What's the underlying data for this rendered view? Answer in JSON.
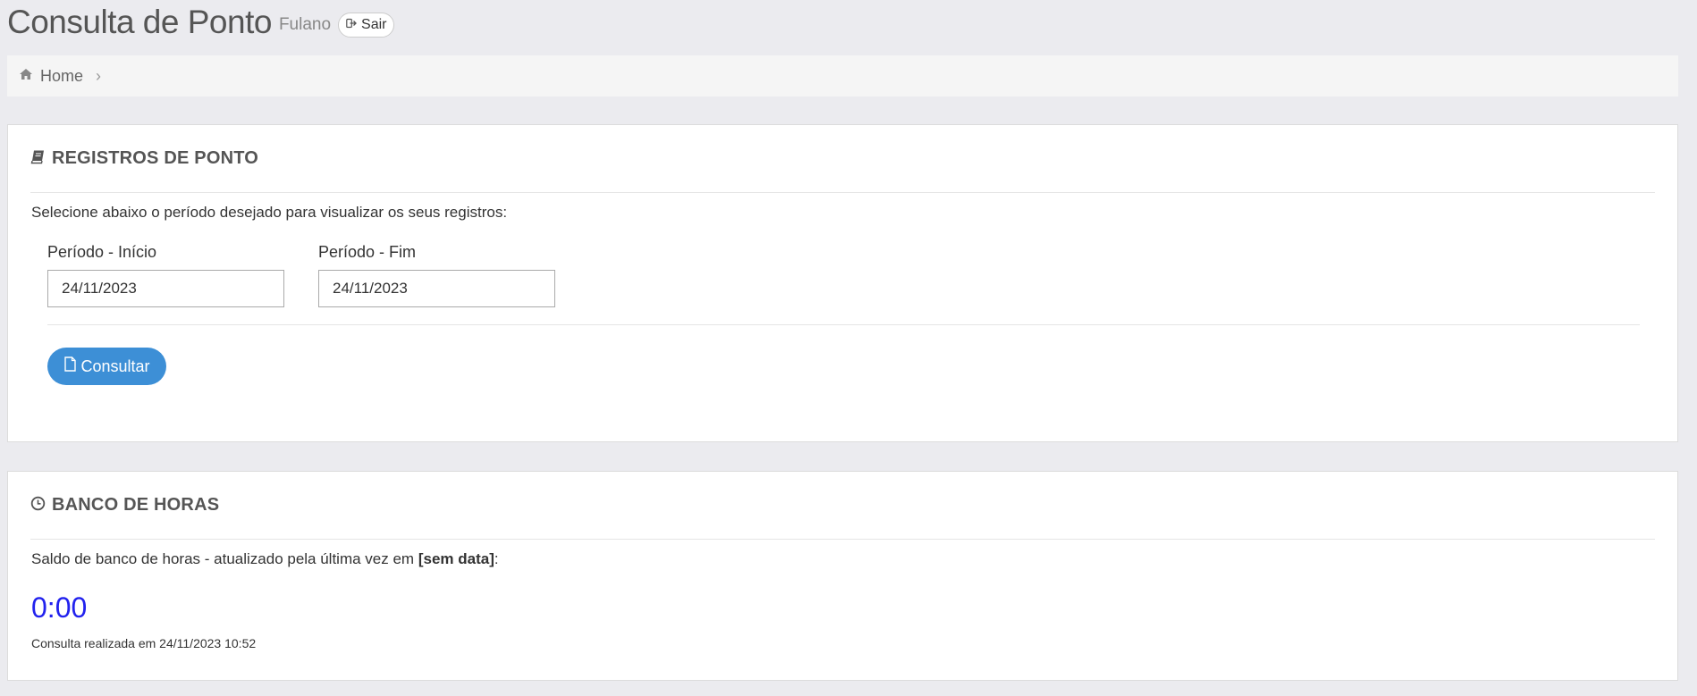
{
  "header": {
    "title": "Consulta de Ponto",
    "user": "Fulano",
    "logout_label": "Sair"
  },
  "breadcrumb": {
    "items": [
      {
        "label": "Home",
        "icon": "home-icon"
      }
    ]
  },
  "registros": {
    "title": "REGISTROS DE PONTO",
    "icon": "book-icon",
    "instruction": "Selecione abaixo o período desejado para visualizar os seus registros:",
    "inicio_label": "Período - Início",
    "inicio_value": "24/11/2023",
    "fim_label": "Período - Fim",
    "fim_value": "24/11/2023",
    "button_label": "Consultar",
    "button_icon": "file-icon"
  },
  "banco": {
    "title": "BANCO DE HORAS",
    "icon": "clock-icon",
    "saldo_prefix": "Saldo de banco de horas - atualizado pela última vez em ",
    "saldo_date": "[sem data]",
    "saldo_suffix": ":",
    "saldo_value": "0:00",
    "consulta_info": "Consulta realizada em 24/11/2023 10:52"
  },
  "colors": {
    "background": "#ebebef",
    "accent": "#3d8fd6",
    "saldo": "#2222ee"
  }
}
